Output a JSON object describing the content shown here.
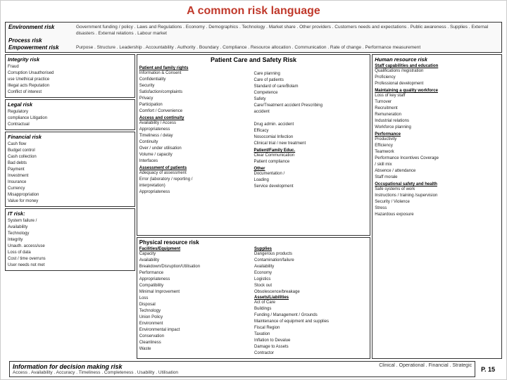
{
  "header": {
    "title": "A common risk language"
  },
  "environment_risk": {
    "label": "Environment risk",
    "description": "Government funding / policy . Laws and Regulations . Economy . Demographics . Technology . Market share . Other providers . Customers needs and expectations . Public awareness . Supplies . External disasters . External relations . Labour market"
  },
  "process_risk": {
    "label": "Process risk"
  },
  "empowerment_risk": {
    "label": "Empowerment risk",
    "description": "Purpose . Structure . Leadership . Accountability . Authority . Boundary . Compliance . Resource allocation . Communication . Rate of change . Performance measurement"
  },
  "integrity_risk": {
    "label": "Integrity risk",
    "items": [
      "Fraud",
      "Corruption Unauthorised use Unethical practice",
      "Illegal acts Reputation",
      "Conflict of interest"
    ]
  },
  "legal_risk": {
    "label": "Legal risk",
    "items": [
      "Regulatory",
      "compliance Litigation",
      "Contractual"
    ]
  },
  "financial_risk": {
    "label": "Financial risk",
    "items": [
      "Cash flow",
      "Budget control",
      "Cash collection",
      "Bad debts",
      "Payment",
      "Investment",
      "Insurance",
      "Currency",
      "Misappropriation",
      "Value for money"
    ]
  },
  "it_risk": {
    "label": "IT risk:",
    "items": [
      "System failure / Availability",
      "Technology",
      "Integrity",
      "Unauth. access/use",
      "Loss of data",
      "Cost / time overruns",
      "User needs not met"
    ]
  },
  "patient_care": {
    "title": "Patient Care and Safety Risk",
    "sections": [
      {
        "title": "Patient and family rights",
        "items": [
          "Information & Consent",
          "Confidentiality",
          "Security",
          "Satisfaction/complaints",
          "Privacy",
          "Participation",
          "Comfort / Convenience"
        ]
      },
      {
        "title": "",
        "items": [
          "Care planning",
          "Care of patients",
          "Standard of care/Bolam",
          "Competence",
          "Safety",
          "Care/Treatment accident Prescribing accident"
        ]
      },
      {
        "title": "Access and continuity",
        "items": [
          "Availability / Access",
          "Appropriateness",
          "Timeliness / delay",
          "Continuity",
          "Over / under utilisation",
          "Volume / capacity",
          "Interfaces"
        ]
      },
      {
        "title": "",
        "items": [
          "Drug admin. accident",
          "Efficacy",
          "Nosocomial Infection",
          "Clinical trial / new treatment"
        ]
      },
      {
        "title": "Assessment of patients",
        "items": [
          "Adequacy of assessment",
          "Error (laboratory / reporting / interpretation)",
          "Appropriateness"
        ]
      },
      {
        "title": "Patient/Family Educ.",
        "items": [
          "Clear Communication",
          "Patient compliance"
        ]
      },
      {
        "title": "",
        "items": []
      },
      {
        "title": "Other",
        "items": [
          "Documentation /",
          "Loading",
          "Service development"
        ]
      }
    ]
  },
  "physical_resource": {
    "title": "Physical resource risk",
    "col1": {
      "title": "Facilities/Equipment",
      "items": [
        "Capacity",
        "Availability",
        "Breakdown/Disruption/Utilisation",
        "Performance",
        "Appropriateness",
        "Compatibility",
        "Minimal Improvement",
        "Loss",
        "Disposal",
        "Technology",
        "Union Policy",
        "Environment",
        "Environmental impact",
        "Conservation",
        "Cleanliness",
        "Waste"
      ]
    },
    "col2": {
      "title": "Supplies",
      "items": [
        "Dangerous products",
        "Contamination/failure",
        "Availability",
        "Economy",
        "Logistics",
        "Stock out",
        "Obsolescence/breakage"
      ],
      "title2": "Assets/Liabilities",
      "items2": [
        "Act of Care",
        "Buildings",
        "Funding / Management / Grounds",
        "Maintenance of equipment and supplies",
        "Fiscal Region",
        "Taxation",
        "Inflation to Devalue",
        "Damage to Assets",
        "Contractor"
      ]
    }
  },
  "human_resource": {
    "title": "Human resource risk",
    "sections": [
      {
        "title": "Staff capabilities and education",
        "items": [
          "Qualifications /registration",
          "Proficiency",
          "Professional development"
        ]
      },
      {
        "title": "Maintaining a quality workforce",
        "items": [
          "Loss of key staff",
          "Turnover",
          "Recruitment",
          "Remuneration",
          "Industrial relations",
          "Workforce planning"
        ]
      },
      {
        "title": "Performance",
        "items": [
          "Productivity",
          "Efficiency",
          "Teamwork",
          "Performance Incentives Coverage",
          "/ skill mix",
          "Absence / attendance",
          "Staff morale"
        ]
      },
      {
        "title": "Occupational safety and health",
        "items": [
          "Safe systems of work",
          "Instructions / training /supervision",
          "Security / Violence",
          "Stress",
          "Hazardous exposure"
        ]
      }
    ]
  },
  "footer": {
    "title": "Information for decision making risk",
    "subtitle": "Access . Availability . Accuracy . Timeliness . Completeness . Usability . Utilisation",
    "right_text": "Clinical . Operational . Financial . Strategic",
    "page": "P. 15"
  }
}
